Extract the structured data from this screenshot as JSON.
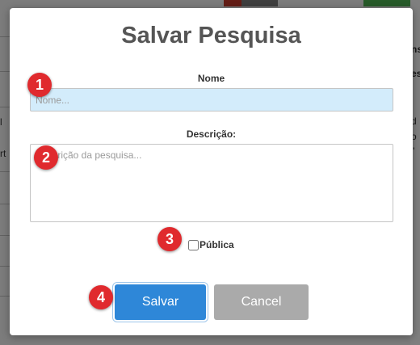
{
  "background": {
    "left_snippets": [
      "l",
      "rt"
    ],
    "right_snippets": [
      "ns",
      "es",
      "d",
      "o",
      "\""
    ],
    "colors": {
      "top_bar_red": "#c0392b",
      "top_bar_gray": "#7a7a7a",
      "top_bar_green": "#4caf50"
    }
  },
  "dialog": {
    "title": "Salvar Pesquisa",
    "name_field": {
      "label": "Nome",
      "value": "",
      "placeholder": "Nome..."
    },
    "description_field": {
      "label": "Descrição:",
      "value": "",
      "placeholder": "Descrição da pesquisa..."
    },
    "public_checkbox": {
      "label": "Pública",
      "checked": false
    },
    "buttons": {
      "save_label": "Salvar",
      "cancel_label": "Cancel"
    }
  },
  "markers": [
    "1",
    "2",
    "3",
    "4"
  ],
  "colors": {
    "save_button": "#2e87d8",
    "cancel_button": "#aaaaaa",
    "marker": "#e02a2e",
    "name_input_bg": "#d3ecfb"
  }
}
